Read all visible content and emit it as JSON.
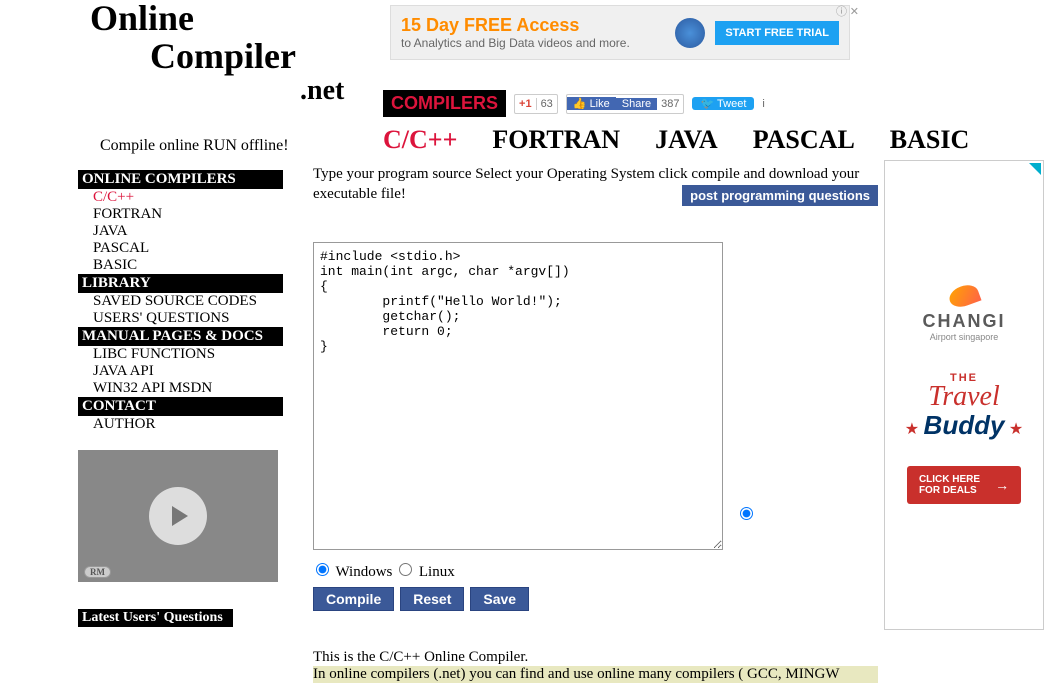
{
  "logo": {
    "line1": "Online",
    "line2": "Compiler",
    "line3": ".net"
  },
  "tagline": "Compile online RUN offline!",
  "ad_top": {
    "title": "15 Day FREE Access",
    "sub": "to Analytics and Big Data videos and more.",
    "btn": "START FREE TRIAL",
    "close": "ⓘ ✕"
  },
  "compilers_badge": "COMPILERS",
  "social": {
    "gplus": "+1",
    "gplus_count": "63",
    "fb_like": "👍 Like",
    "fb_share": "Share",
    "fb_count": "387",
    "tweet": "🐦 Tweet",
    "tweet_i": "i"
  },
  "tabs": {
    "cpp": "C/C++",
    "fortran": "FORTRAN",
    "java": "JAVA",
    "pascal": "PASCAL",
    "basic": "BASIC"
  },
  "sidebar": {
    "h1": "ONLINE COMPILERS",
    "items1": [
      "C/C++",
      "FORTRAN",
      "JAVA",
      "PASCAL",
      "BASIC"
    ],
    "h2": "LIBRARY",
    "items2": [
      "SAVED SOURCE CODES",
      "USERS' QUESTIONS"
    ],
    "h3": "MANUAL PAGES & DOCS",
    "items3": [
      "LIBC FUNCTIONS",
      "JAVA API",
      "WIN32 API MSDN"
    ],
    "h4": "CONTACT",
    "items4": [
      "AUTHOR"
    ],
    "rm": "RM",
    "latest": "Latest Users' Questions"
  },
  "main": {
    "instruction": "Type your program source Select your Operating System click compile and download your executable file!",
    "post_link": "post programming questions",
    "code": "#include <stdio.h>\nint main(int argc, char *argv[])\n{\n        printf(\"Hello World!\");\n        getchar();\n        return 0;\n}",
    "os": {
      "windows": "Windows",
      "linux": "Linux"
    },
    "buttons": {
      "compile": "Compile",
      "reset": "Reset",
      "save": "Save"
    },
    "bottom1": "This is the C/C++ Online Compiler.",
    "bottom2": "In online compilers (.net) you can find and use online many compilers ( GCC, MINGW"
  },
  "sidebar_ad": {
    "changi": "CHANGI",
    "changi_sub": "Airport singapore",
    "the": "THE",
    "travel": "Travel",
    "buddy": "Buddy",
    "deals": "CLICK HERE\nFOR DEALS",
    "arrow": "→"
  }
}
